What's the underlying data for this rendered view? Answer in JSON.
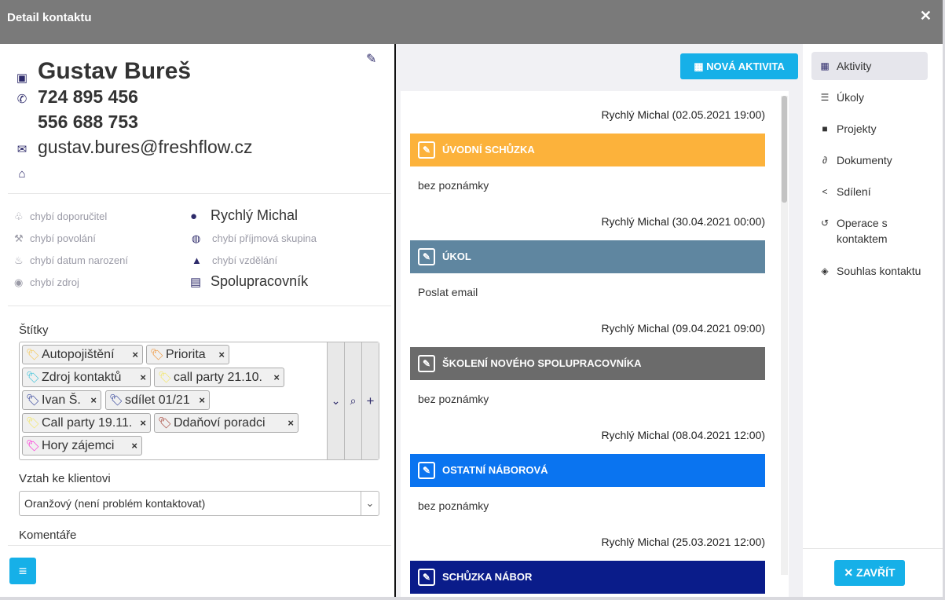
{
  "window": {
    "title": "Detail kontaktu",
    "close_glyph": "✕"
  },
  "contact": {
    "name": "Gustav Bureš",
    "phones": [
      "724 895 456",
      "556 688 753"
    ],
    "email": "gustav.bures@freshflow.cz"
  },
  "meta": {
    "left": [
      {
        "icon": "hand-plant-icon",
        "text": "chybí doporučitel"
      },
      {
        "icon": "worker-icon",
        "text": "chybí povolání"
      },
      {
        "icon": "cake-icon",
        "text": "chybí datum narození"
      },
      {
        "icon": "broadcast-icon",
        "text": "chybí zdroj"
      }
    ],
    "right": [
      {
        "icon": "user-icon",
        "text": "Rychlý Michal",
        "strong": true
      },
      {
        "icon": "money-bag-icon",
        "text": "chybí příjmová skupina",
        "strong": false
      },
      {
        "icon": "graduation-cap-icon",
        "text": "chybí vzdělání",
        "strong": false
      },
      {
        "icon": "chart-file-icon",
        "text": "Spolupracovník",
        "strong": true
      }
    ]
  },
  "tags": {
    "label": "Štítky",
    "items": [
      {
        "text": "Autopojištění",
        "color": "#f6c445"
      },
      {
        "text": "Priorita",
        "color": "#f08a24"
      },
      {
        "text": "Zdroj kontaktů",
        "color": "#25bcd6"
      },
      {
        "text": "call party 21.10.",
        "color": "#f3e65a"
      },
      {
        "text": "Ivan Š.",
        "color": "#1b2d8f"
      },
      {
        "text": "sdílet 01/21",
        "color": "#1b2d8f"
      },
      {
        "text": "Call party 19.11.",
        "color": "#f3e65a"
      },
      {
        "text": "Ddaňoví poradci",
        "color": "#9b2b1d"
      },
      {
        "text": "Hory zájemci",
        "color": "#ff14d4"
      }
    ],
    "remove_glyph": "×"
  },
  "relation": {
    "label": "Vztah ke klientovi",
    "value": "Oranžový (není problém kontaktovat)"
  },
  "comments": {
    "label": "Komentáře"
  },
  "toolbar": {
    "new_activity": "NOVÁ AKTIVITA",
    "close": "ZAVŘÍT"
  },
  "activities": [
    {
      "author": "Rychlý Michal (02.05.2021 19:00)",
      "title": "ÚVODNÍ SCHŮZKA",
      "note": "bez poznámky",
      "color": "#fcb23b"
    },
    {
      "author": "Rychlý Michal (30.04.2021 00:00)",
      "title": "ÚKOL",
      "note": "Poslat email",
      "color": "#5f86a0"
    },
    {
      "author": "Rychlý Michal (09.04.2021 09:00)",
      "title": "ŠKOLENÍ NOVÉHO SPOLUPRACOVNÍKA",
      "note": "bez poznámky",
      "color": "#6b6b6b"
    },
    {
      "author": "Rychlý Michal (08.04.2021 12:00)",
      "title": "OSTATNÍ NÁBOROVÁ",
      "note": "bez poznámky",
      "color": "#0a74f0"
    },
    {
      "author": "Rychlý Michal (25.03.2021 12:00)",
      "title": "SCHŮZKA NÁBOR",
      "note": "",
      "color": "#0a1c8a"
    }
  ],
  "nav": [
    {
      "icon": "calendar-icon",
      "label": "Aktivity",
      "active": true
    },
    {
      "icon": "list-icon",
      "label": "Úkoly",
      "active": false
    },
    {
      "icon": "folder-icon",
      "label": "Projekty",
      "active": false
    },
    {
      "icon": "paperclip-icon",
      "label": "Dokumenty",
      "active": false
    },
    {
      "icon": "share-icon",
      "label": "Sdílení",
      "active": false
    },
    {
      "icon": "history-icon",
      "label": "Operace s kontaktem",
      "active": false
    },
    {
      "icon": "handshake-icon",
      "label": "Souhlas kontaktu",
      "active": false
    }
  ]
}
